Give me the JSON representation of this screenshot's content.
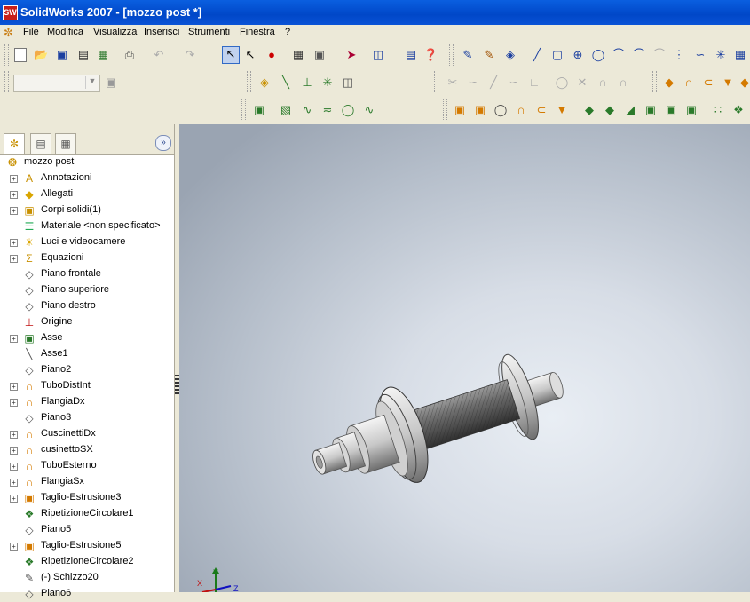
{
  "window": {
    "title": "SolidWorks 2007 - [mozzo post *]",
    "app_badge": "SW"
  },
  "menu": [
    "File",
    "Modifica",
    "Visualizza",
    "Inserisci",
    "Strumenti",
    "Finestra",
    "?"
  ],
  "tree": {
    "root": "mozzo post",
    "items": [
      {
        "label": "Annotazioni",
        "icon": "annotation-icon",
        "expandable": true
      },
      {
        "label": "Allegati",
        "icon": "attachment-icon",
        "expandable": true
      },
      {
        "label": "Corpi solidi(1)",
        "icon": "solid-bodies-icon",
        "expandable": true
      },
      {
        "label": "Materiale <non specificato>",
        "icon": "material-icon",
        "expandable": false
      },
      {
        "label": "Luci e videocamere",
        "icon": "lights-icon",
        "expandable": true
      },
      {
        "label": "Equazioni",
        "icon": "equations-icon",
        "expandable": true
      },
      {
        "label": "Piano frontale",
        "icon": "plane-icon",
        "expandable": false
      },
      {
        "label": "Piano superiore",
        "icon": "plane-icon",
        "expandable": false
      },
      {
        "label": "Piano destro",
        "icon": "plane-icon",
        "expandable": false
      },
      {
        "label": "Origine",
        "icon": "origin-icon",
        "expandable": false
      },
      {
        "label": "Asse",
        "icon": "axis-feature-icon",
        "expandable": true
      },
      {
        "label": "Asse1",
        "icon": "axis-icon",
        "expandable": false
      },
      {
        "label": "Piano2",
        "icon": "plane-icon",
        "expandable": false
      },
      {
        "label": "TuboDistInt",
        "icon": "revolve-icon",
        "expandable": true
      },
      {
        "label": "FlangiaDx",
        "icon": "revolve-icon",
        "expandable": true
      },
      {
        "label": "Piano3",
        "icon": "plane-icon",
        "expandable": false
      },
      {
        "label": "CuscinettiDx",
        "icon": "revolve-icon",
        "expandable": true
      },
      {
        "label": "cusinettoSX",
        "icon": "revolve-icon",
        "expandable": true
      },
      {
        "label": "TuboEsterno",
        "icon": "revolve-icon",
        "expandable": true
      },
      {
        "label": "FlangiaSx",
        "icon": "revolve-icon",
        "expandable": true
      },
      {
        "label": "Taglio-Estrusione3",
        "icon": "cut-extrude-icon",
        "expandable": true
      },
      {
        "label": "RipetizioneCircolare1",
        "icon": "circular-pattern-icon",
        "expandable": false
      },
      {
        "label": "Piano5",
        "icon": "plane-icon",
        "expandable": false
      },
      {
        "label": "Taglio-Estrusione5",
        "icon": "cut-extrude-icon",
        "expandable": true
      },
      {
        "label": "RipetizioneCircolare2",
        "icon": "circular-pattern-icon",
        "expandable": false
      },
      {
        "label": "(-) Schizzo20",
        "icon": "sketch-icon",
        "expandable": false
      },
      {
        "label": "Piano6",
        "icon": "plane-icon",
        "expandable": false
      }
    ]
  },
  "triad": {
    "y": "Y",
    "x": "X",
    "z": "Z"
  }
}
